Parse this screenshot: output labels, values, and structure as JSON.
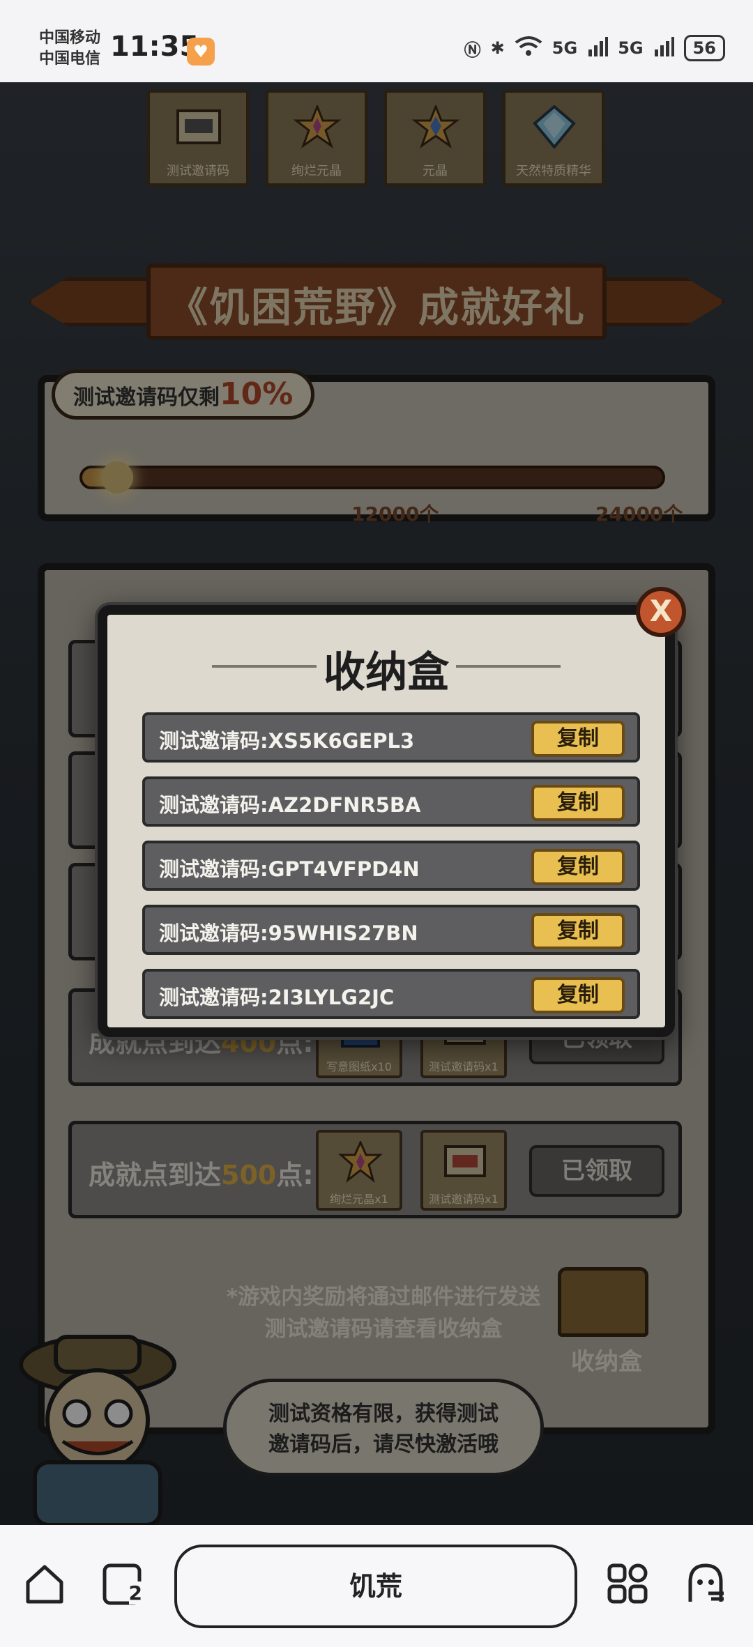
{
  "status_bar": {
    "carrier_1": "中国移动",
    "carrier_2": "中国电信",
    "time": "11:35",
    "battery": "56",
    "signal_1": "5G",
    "signal_2": "5G"
  },
  "top_rewards": [
    {
      "label": "测试邀请码",
      "icon": "scroll-icon"
    },
    {
      "label": "绚烂元晶",
      "icon": "star-crystal-icon"
    },
    {
      "label": "元晶",
      "icon": "blue-star-icon"
    },
    {
      "label": "天然特质精华",
      "icon": "gem-icon"
    }
  ],
  "banner": {
    "title": "《饥困荒野》成就好礼"
  },
  "progress": {
    "bubble_prefix": "测试邀请码仅剩",
    "bubble_pct": "10%",
    "fraction": 0.06,
    "tick_1": "12000个",
    "tick_2": "24000个"
  },
  "achievement_rows": [
    {
      "prefix": "成就点到达",
      "points": "400",
      "suffix": "点:",
      "items": [
        {
          "label": "写意图纸x10",
          "icon": "blueprint-icon"
        },
        {
          "label": "测试邀请码x1",
          "icon": "scroll-icon"
        }
      ],
      "button": "已领取"
    },
    {
      "prefix": "成就点到达",
      "points": "500",
      "suffix": "点:",
      "items": [
        {
          "label": "绚烂元晶x1",
          "icon": "star-crystal-icon"
        },
        {
          "label": "测试邀请码x1",
          "icon": "scroll-icon"
        }
      ],
      "button": "已领取"
    }
  ],
  "notice": {
    "line_1": "*游戏内奖励将通过邮件进行发送",
    "line_2": "测试邀请码请查看收纳盒"
  },
  "storage_entry": {
    "label": "收纳盒"
  },
  "speech": {
    "line_1": "测试资格有限，获得测试",
    "line_2": "邀请码后，请尽快激活哦"
  },
  "modal": {
    "title": "收纳盒",
    "close_label": "X",
    "codes": [
      {
        "text": "测试邀请码:XS5K6GEPL3",
        "button": "复制"
      },
      {
        "text": "测试邀请码:AZ2DFNR5BA",
        "button": "复制"
      },
      {
        "text": "测试邀请码:GPT4VFPD4N",
        "button": "复制"
      },
      {
        "text": "测试邀请码:95WHIS27BN",
        "button": "复制"
      },
      {
        "text": "测试邀请码:2I3LYLG2JC",
        "button": "复制"
      }
    ]
  },
  "bottom_nav": {
    "center_label": "饥荒",
    "tabs_count": "2"
  }
}
